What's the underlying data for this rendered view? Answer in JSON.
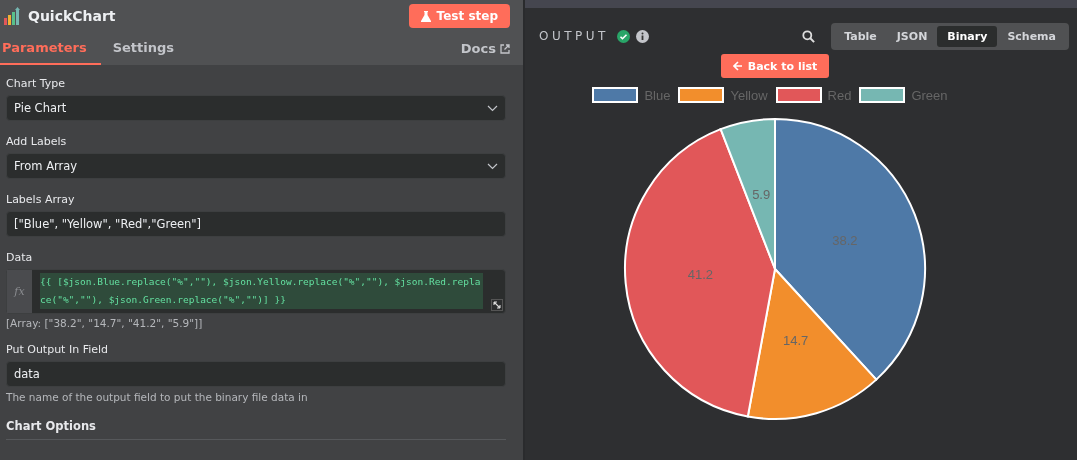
{
  "node": {
    "title": "QuickChart",
    "test_button": "Test step"
  },
  "tabs": [
    {
      "label": "Parameters",
      "selected": true
    },
    {
      "label": "Settings",
      "selected": false
    }
  ],
  "docs_link": "Docs",
  "fields": [
    {
      "kind": "select",
      "label": "Chart Type",
      "value": "Pie Chart"
    },
    {
      "kind": "select",
      "label": "Add Labels",
      "value": "From Array"
    },
    {
      "kind": "input",
      "label": "Labels Array",
      "value": "[\"Blue\", \"Yellow\", \"Red\",\"Green\"]"
    },
    {
      "kind": "expression",
      "label": "Data",
      "prefix": "fx",
      "value": "{{ [$json.Blue.replace(\"%\",\"\"), $json.Yellow.replace(\"%\",\"\"), $json.Red.replace(\"%\",\"\"), $json.Green.replace(\"%\",\"\")] }}",
      "result": "[Array: [\"38.2\", \"14.7\", \"41.2\", \"5.9\"]]"
    },
    {
      "kind": "input",
      "label": "Put Output In Field",
      "value": "data",
      "hint": "The name of the output field to put the binary file data in"
    }
  ],
  "section": "Chart Options",
  "output": {
    "title": "OUTPUT",
    "view_tabs": [
      {
        "label": "Table",
        "selected": false
      },
      {
        "label": "JSON",
        "selected": false
      },
      {
        "label": "Binary",
        "selected": true
      },
      {
        "label": "Schema",
        "selected": false
      }
    ],
    "back_button": "Back to list",
    "legend": [
      {
        "color": "#4e79a7"
      },
      {
        "color": "#f28e2c"
      },
      {
        "color": "#e15759"
      },
      {
        "color": "#76b7b2"
      }
    ],
    "chart_data": {
      "type": "pie",
      "categories": [
        "Blue",
        "Yellow",
        "Red",
        "Green"
      ],
      "series": [
        {
          "values": [
            38.2,
            14.7,
            41.2,
            5.9
          ]
        }
      ],
      "data_labels": true
    }
  }
}
